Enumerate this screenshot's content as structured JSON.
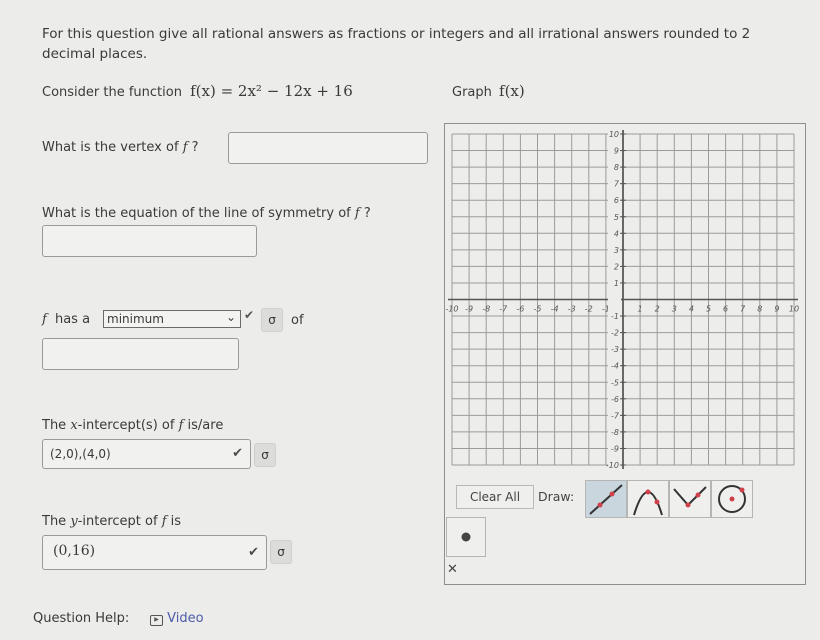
{
  "instructions": "For this question give all rational answers as fractions or integers and all irrational answers rounded to 2 decimal places.",
  "function_prompt": {
    "lead": "Consider the function",
    "function_tex": "f(x) = 2x² − 12x + 16",
    "graph_label": "Graph",
    "graph_func": "f(x)"
  },
  "questions": {
    "vertex": {
      "label": "What is the vertex of",
      "fname": "f",
      "suffix": "?",
      "value": ""
    },
    "symmetry": {
      "label": "What is the equation of the line of symmetry of",
      "fname": "f",
      "suffix": "?",
      "value": ""
    },
    "extremum": {
      "prefix_f": "f",
      "has_a": "has a",
      "selected": "minimum",
      "of": "of",
      "value": "",
      "status": "correct"
    },
    "x_intercepts": {
      "label_pre": "The",
      "var": "x",
      "label_mid": "-intercept(s) of",
      "fname": "f",
      "label_post": "is/are",
      "value": "(2,0),(4,0)",
      "status": "correct"
    },
    "y_intercept": {
      "label_pre": "The",
      "var": "y",
      "label_mid": "-intercept of",
      "fname": "f",
      "label_post": "is",
      "value": "(0,16)",
      "status": "correct"
    }
  },
  "icons": {
    "check": "✔",
    "sigma": "σ",
    "dropdown": "⌄",
    "close": "✕",
    "play": "▶"
  },
  "graph": {
    "x_range": [
      -10,
      10
    ],
    "y_range": [
      -10,
      10
    ],
    "x_ticks": [
      "-10",
      "-9",
      "-8",
      "-7",
      "-6",
      "-5",
      "-4",
      "-3",
      "-2",
      "-1",
      "1",
      "2",
      "3",
      "4",
      "5",
      "6",
      "7",
      "8",
      "9",
      "10"
    ],
    "y_ticks": [
      "10",
      "9",
      "8",
      "7",
      "6",
      "5",
      "4",
      "3",
      "2",
      "1",
      "-1",
      "-2",
      "-3",
      "-4",
      "-5",
      "-6",
      "-7",
      "-8",
      "-9",
      "-10"
    ],
    "grid": true
  },
  "toolbar": {
    "clear_all": "Clear All",
    "draw_label": "Draw:",
    "tools": [
      "line",
      "parabola",
      "absolute-value",
      "circle"
    ],
    "selected_tool": "line",
    "point_tool": "point"
  },
  "help": {
    "label": "Question Help:",
    "video": "Video"
  },
  "colors": {
    "accent_point": "#d0404a",
    "link": "#4b5aa8",
    "selected_tool": "#c9d6de"
  }
}
